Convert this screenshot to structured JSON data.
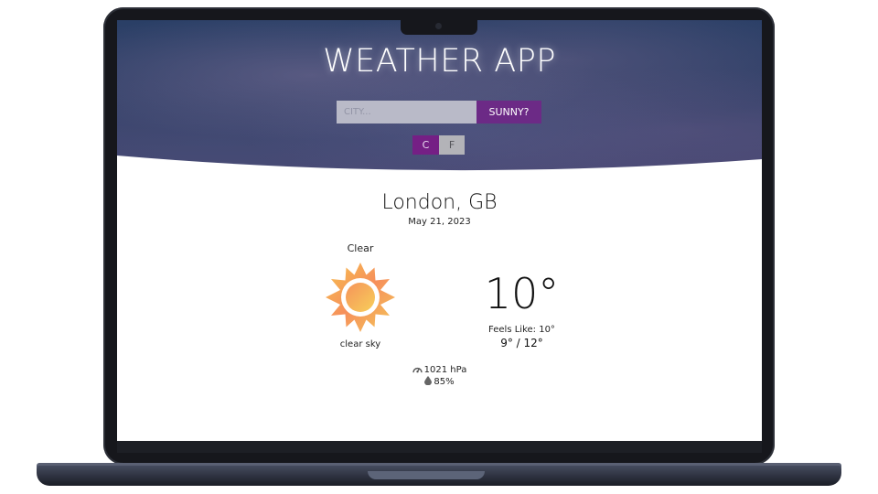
{
  "header": {
    "title": "WEATHER APP",
    "search": {
      "placeholder": "CITY...",
      "value": "",
      "button_label": "SUNNY?"
    },
    "units": {
      "celsius_label": "C",
      "fahrenheit_label": "F",
      "selected": "C",
      "accent_color": "#751f85"
    }
  },
  "weather": {
    "location": "London, GB",
    "date": "May 21, 2023",
    "condition": "Clear",
    "description": "clear sky",
    "icon": "sun-icon",
    "temperature": "10°",
    "feels_like": "Feels Like: 10°",
    "min_max": "9° / 12°",
    "pressure": "1021 hPa",
    "humidity": "85%"
  },
  "icons": {
    "pressure": "gauge-icon",
    "humidity": "droplet-icon"
  }
}
